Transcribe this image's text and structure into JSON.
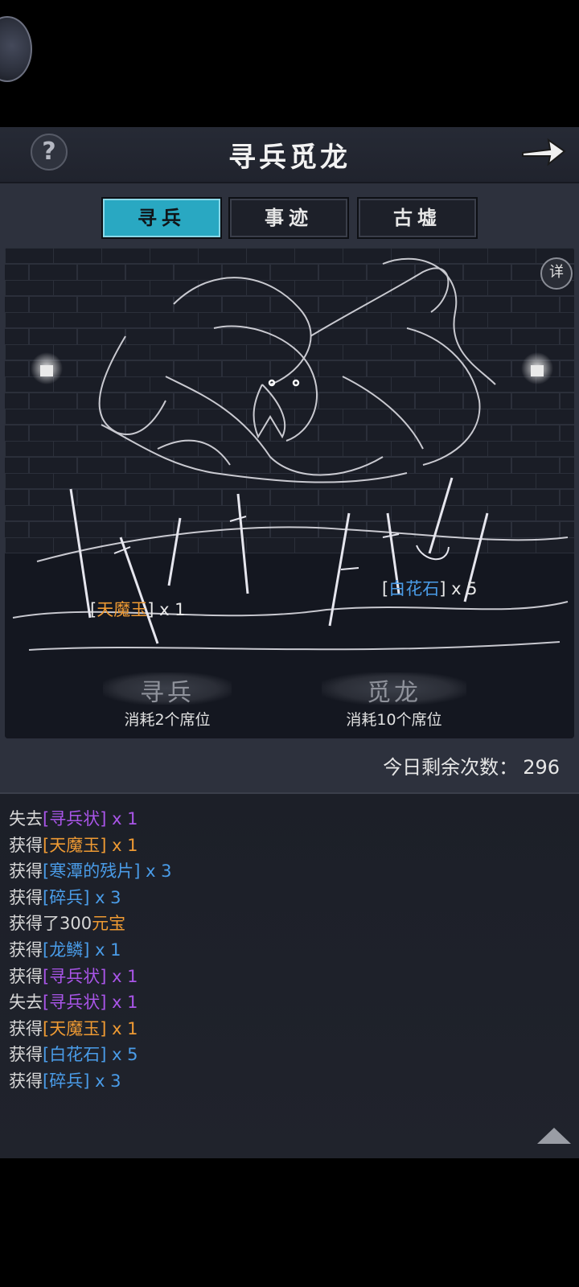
{
  "header": {
    "title": "寻兵觅龙",
    "help_label": "?"
  },
  "tabs": [
    {
      "label": "寻兵",
      "active": true
    },
    {
      "label": "事迹",
      "active": false
    },
    {
      "label": "古墟",
      "active": false
    }
  ],
  "scene": {
    "detail_label": "详",
    "rewards": [
      {
        "open": "[",
        "item": "天魔玉",
        "close": "]",
        "qty": " x 1",
        "color": "#ee9a33"
      },
      {
        "open": "[",
        "item": "白花石",
        "close": "]",
        "qty": " x 5",
        "color": "#4a9ce8"
      }
    ]
  },
  "actions": [
    {
      "title": "寻兵",
      "subtitle": "消耗2个席位"
    },
    {
      "title": "觅龙",
      "subtitle": "消耗10个席位"
    }
  ],
  "remaining": {
    "label": "今日剩余次数：",
    "value": "296"
  },
  "log": [
    {
      "prefix": "失去",
      "item": "[寻兵状]",
      "qty": " x 1",
      "color": "#a955e8"
    },
    {
      "prefix": "获得",
      "item": "[天魔玉]",
      "qty": " x 1",
      "color": "#ee9a33"
    },
    {
      "prefix": "获得",
      "item": "[寒潭的残片]",
      "qty": " x 3",
      "color": "#4a9ce8"
    },
    {
      "prefix": "获得",
      "item": "[碎兵]",
      "qty": " x 3",
      "color": "#4a9ce8"
    },
    {
      "prefix": "获得了300",
      "item": "元宝",
      "qty": "",
      "color": "#ee9a33"
    },
    {
      "prefix": "获得",
      "item": "[龙鳞]",
      "qty": " x 1",
      "color": "#4a9ce8"
    },
    {
      "prefix": "获得",
      "item": "[寻兵状]",
      "qty": " x 1",
      "color": "#a955e8"
    },
    {
      "prefix": "失去",
      "item": "[寻兵状]",
      "qty": " x 1",
      "color": "#a955e8"
    },
    {
      "prefix": "获得",
      "item": "[天魔玉]",
      "qty": " x 1",
      "color": "#ee9a33"
    },
    {
      "prefix": "获得",
      "item": "[白花石]",
      "qty": " x 5",
      "color": "#4a9ce8"
    },
    {
      "prefix": "获得",
      "item": "[碎兵]",
      "qty": " x 3",
      "color": "#4a9ce8"
    }
  ],
  "colors": {
    "accent": "#29a8c2",
    "orange": "#ee9a33",
    "blue": "#4a9ce8",
    "purple": "#a955e8"
  }
}
